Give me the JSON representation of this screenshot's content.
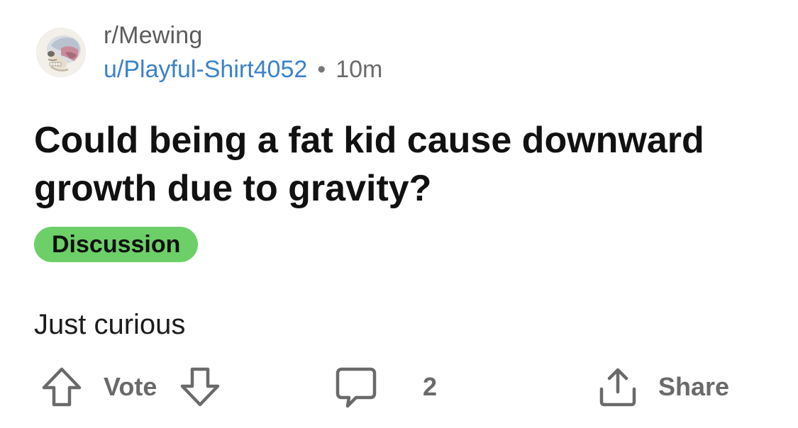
{
  "post": {
    "subreddit": "r/Mewing",
    "author": "u/Playful-Shirt4052",
    "separator": "•",
    "time_ago": "10m",
    "title": "Could being a fat kid cause downward growth due to gravity?",
    "flair": "Discussion",
    "body": "Just curious"
  },
  "actions": {
    "vote_label": "Vote",
    "comment_count": "2",
    "share_label": "Share"
  },
  "colors": {
    "author_link": "#3b82c8",
    "flair_bg": "#6dcf68",
    "action_gray": "#6a6a6a"
  },
  "icons": {
    "avatar": "skull-anatomy-avatar",
    "upvote": "arrow-up-icon",
    "downvote": "arrow-down-icon",
    "comment": "comment-bubble-icon",
    "share": "share-icon"
  }
}
